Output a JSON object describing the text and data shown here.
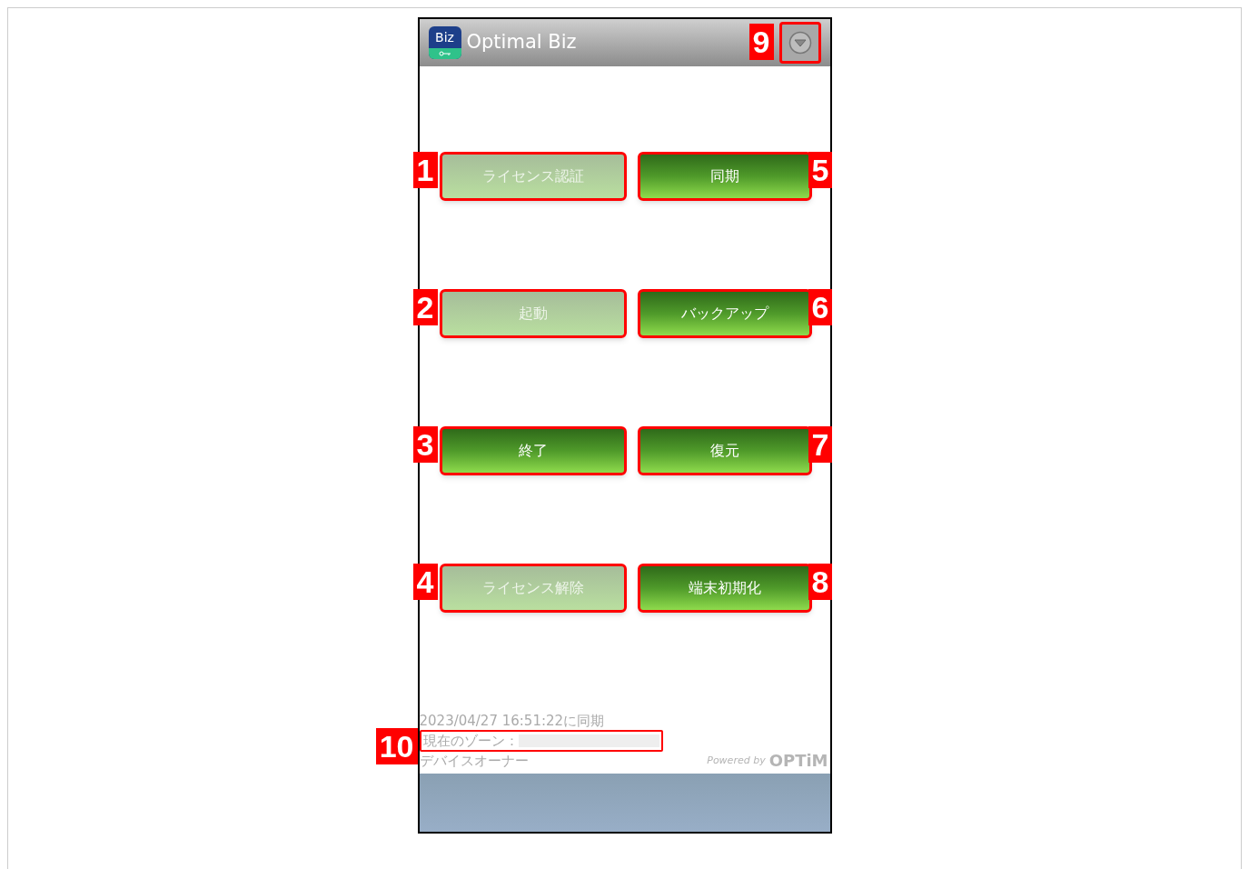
{
  "header": {
    "logo_text": "Biz",
    "title": "Optimal Biz",
    "menu_callout": "9"
  },
  "buttons": [
    {
      "label": "ライセンス認証",
      "disabled": true,
      "callout": "1"
    },
    {
      "label": "同期",
      "disabled": false,
      "callout": "5"
    },
    {
      "label": "起動",
      "disabled": true,
      "callout": "2"
    },
    {
      "label": "バックアップ",
      "disabled": false,
      "callout": "6"
    },
    {
      "label": "終了",
      "disabled": false,
      "callout": "3"
    },
    {
      "label": "復元",
      "disabled": false,
      "callout": "7"
    },
    {
      "label": "ライセンス解除",
      "disabled": true,
      "callout": "4"
    },
    {
      "label": "端末初期化",
      "disabled": false,
      "callout": "8"
    }
  ],
  "status": {
    "sync_text": "2023/04/27 16:51:22に同期",
    "zone_label": "現在のゾーン：",
    "zone_callout": "10",
    "owner": "デバイスオーナー"
  },
  "footer": {
    "powered_by": "Powered by",
    "brand": "OPTiM"
  }
}
